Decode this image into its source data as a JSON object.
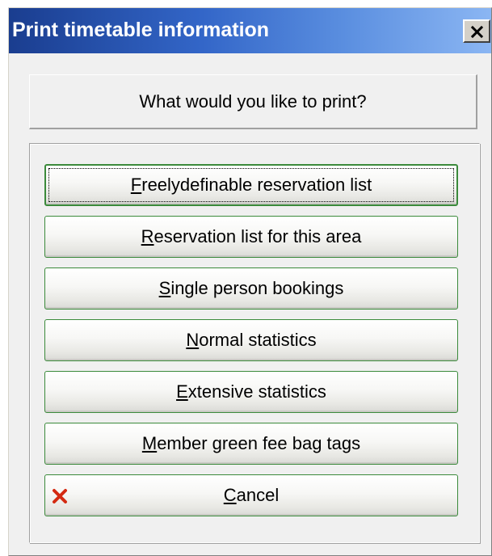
{
  "window": {
    "title": "Print timetable information",
    "close_icon": "close-icon"
  },
  "question": {
    "text": "What would you like to print?"
  },
  "buttons": [
    {
      "accel": "F",
      "rest": "reelydefinable reservation list",
      "focused": true
    },
    {
      "accel": "R",
      "rest": "eservation list for this area"
    },
    {
      "accel": "S",
      "rest": "ingle person bookings"
    },
    {
      "accel": "N",
      "rest": "ormal statistics"
    },
    {
      "accel": "E",
      "rest": "xtensive statistics"
    },
    {
      "accel": "M",
      "rest": "ember green fee bag tags"
    }
  ],
  "cancel": {
    "accel": "C",
    "rest": "ancel",
    "icon": "cancel-x-icon",
    "icon_color": "#d42a12"
  },
  "colors": {
    "title_gradient_start": "#1a3d8f",
    "title_gradient_end": "#8bb6f3",
    "button_border": "#3b8a3b"
  }
}
